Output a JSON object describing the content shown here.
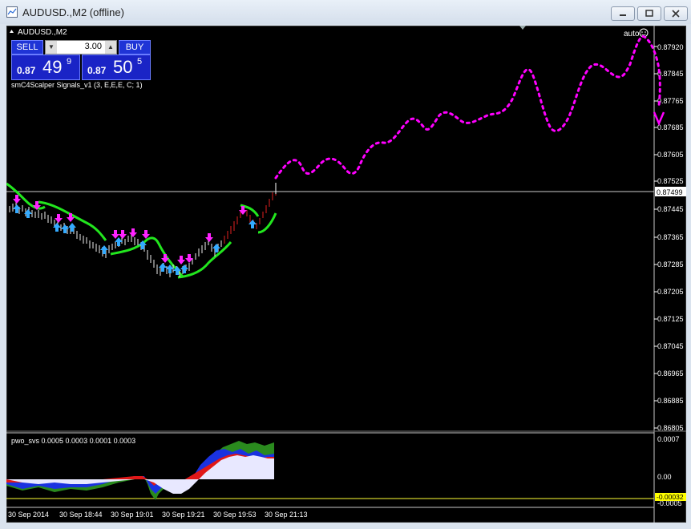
{
  "window": {
    "title": "AUDUSD.,M2 (offline)",
    "buttons": [
      "minimize",
      "restore",
      "close"
    ]
  },
  "chart": {
    "symbol_label": "AUDUSD.,M2",
    "indicator_label": "smC4Scalper Signals_v1 (3, E,E,E, C; 1)",
    "auto_label": "auto",
    "current_price_label": "0.87499",
    "colors": {
      "background": "#000000",
      "band": "#22e61e",
      "prediction": "#ff00ff",
      "up_arrow": "#33aaff",
      "down_arrow": "#ff22ff",
      "current_price_bg": "#ffffff",
      "sub_current_bg": "#ffff00"
    }
  },
  "trade_panel": {
    "sell_label": "SELL",
    "buy_label": "BUY",
    "lot": "3.00",
    "lot_down": "▼",
    "lot_up": "▲",
    "bid": {
      "prefix": "0.87",
      "big": "49",
      "sup": "9"
    },
    "ask": {
      "prefix": "0.87",
      "big": "50",
      "sup": "5"
    }
  },
  "price_axis": [
    "0.87920",
    "0.87845",
    "0.87765",
    "0.87685",
    "0.87605",
    "0.87525",
    "0.87445",
    "0.87365",
    "0.87285",
    "0.87205",
    "0.87125",
    "0.87045",
    "0.86965",
    "0.86885",
    "0.86805"
  ],
  "subwindow": {
    "label": "pwo_svs 0.0005 0.0003 0.0001 0.0003",
    "axis": [
      "0.0007",
      "0.00",
      "-0.00032",
      "-0.0005"
    ]
  },
  "time_axis": [
    "30 Sep 2014",
    "30 Sep 18:44",
    "30 Sep 19:01",
    "30 Sep 19:21",
    "30 Sep 19:53",
    "30 Sep 21:13"
  ]
}
